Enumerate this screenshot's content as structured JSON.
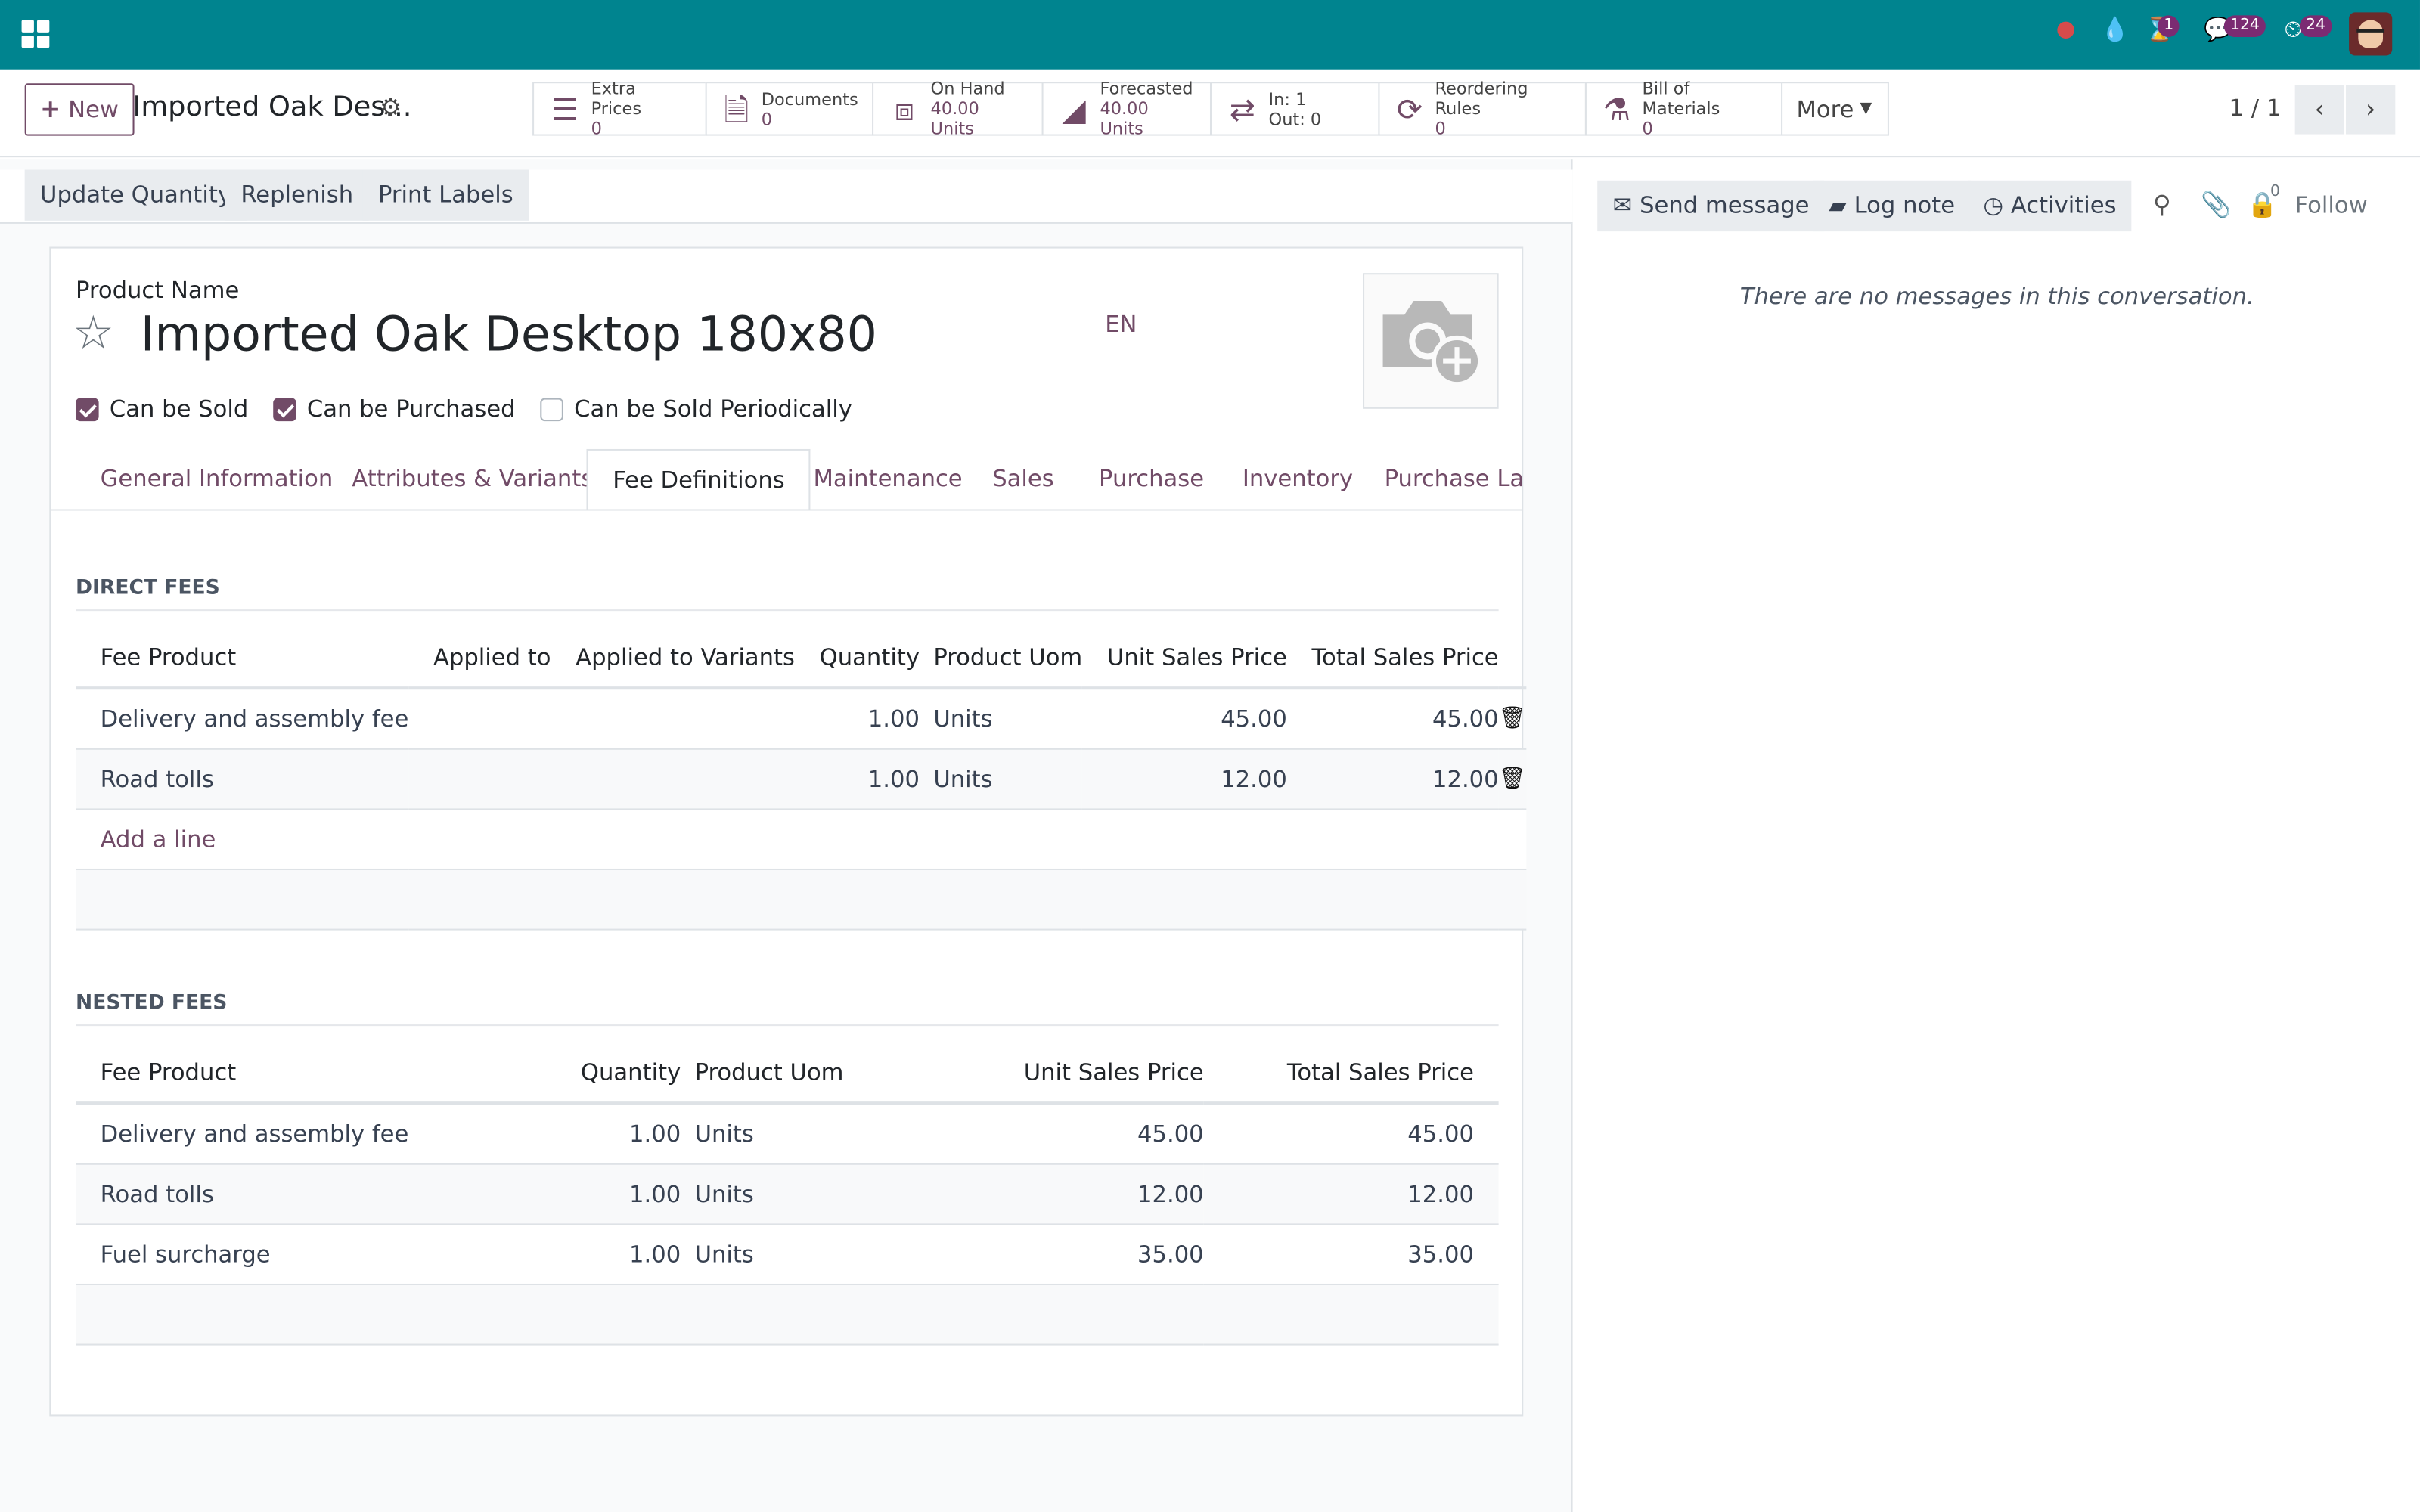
{
  "topbar": {
    "badges": {
      "activities": "1",
      "messages": "124",
      "timesheet": "24"
    }
  },
  "control": {
    "new_label": "New",
    "record_title": "Imported Oak Des...",
    "stats": [
      {
        "label": "Extra Prices",
        "value": "0",
        "icon": "list-icon"
      },
      {
        "label": "Documents",
        "value": "0",
        "icon": "document-icon"
      },
      {
        "label": "On Hand",
        "value": "40.00 Units",
        "icon": "cubes-icon"
      },
      {
        "label": "Forecasted",
        "value": "40.00 Units",
        "icon": "area-chart-icon"
      },
      {
        "label": "In: 1",
        "value": "Out: 0",
        "icon": "exchange-icon"
      },
      {
        "label": "Reordering Rules",
        "value": "0",
        "icon": "refresh-icon"
      },
      {
        "label": "Bill of Materials",
        "value": "0",
        "icon": "flask-icon"
      }
    ],
    "more_label": "More",
    "pager": "1 / 1"
  },
  "statusbar": {
    "buttons": [
      "Update Quantity",
      "Replenish",
      "Print Labels"
    ]
  },
  "form": {
    "product_name_label": "Product Name",
    "product_name": "Imported Oak Desktop 180x80",
    "lang": "EN",
    "checkboxes": [
      {
        "label": "Can be Sold",
        "checked": true
      },
      {
        "label": "Can be Purchased",
        "checked": true
      },
      {
        "label": "Can be Sold Periodically",
        "checked": false
      }
    ],
    "tabs": [
      "General Information",
      "Attributes & Variants",
      "Fee Definitions",
      "Maintenance",
      "Sales",
      "Purchase",
      "Inventory",
      "Purchase Lan"
    ],
    "active_tab": "Fee Definitions"
  },
  "direct_fees": {
    "title": "DIRECT FEES",
    "columns": [
      "Fee Product",
      "Applied to",
      "Applied to Variants",
      "Quantity",
      "Product Uom",
      "Unit Sales Price",
      "Total Sales Price"
    ],
    "rows": [
      {
        "product": "Delivery and assembly fee",
        "applied_to": "",
        "variants": "",
        "qty": "1.00",
        "uom": "Units",
        "unit": "45.00",
        "total": "45.00"
      },
      {
        "product": "Road tolls",
        "applied_to": "",
        "variants": "",
        "qty": "1.00",
        "uom": "Units",
        "unit": "12.00",
        "total": "12.00"
      }
    ],
    "add_line": "Add a line"
  },
  "nested_fees": {
    "title": "NESTED FEES",
    "columns": [
      "Fee Product",
      "Quantity",
      "Product Uom",
      "Unit Sales Price",
      "Total Sales Price"
    ],
    "rows": [
      {
        "product": "Delivery and assembly fee",
        "qty": "1.00",
        "uom": "Units",
        "unit": "45.00",
        "total": "45.00"
      },
      {
        "product": "Road tolls",
        "qty": "1.00",
        "uom": "Units",
        "unit": "12.00",
        "total": "12.00"
      },
      {
        "product": "Fuel surcharge",
        "qty": "1.00",
        "uom": "Units",
        "unit": "35.00",
        "total": "35.00"
      }
    ]
  },
  "chatter": {
    "send_message": "Send message",
    "log_note": "Log note",
    "activities": "Activities",
    "followers_count": "0",
    "follow": "Follow",
    "empty": "There are no messages in this conversation."
  },
  "colors": {
    "brand_bar": "#00848f",
    "accent": "#714b67"
  }
}
